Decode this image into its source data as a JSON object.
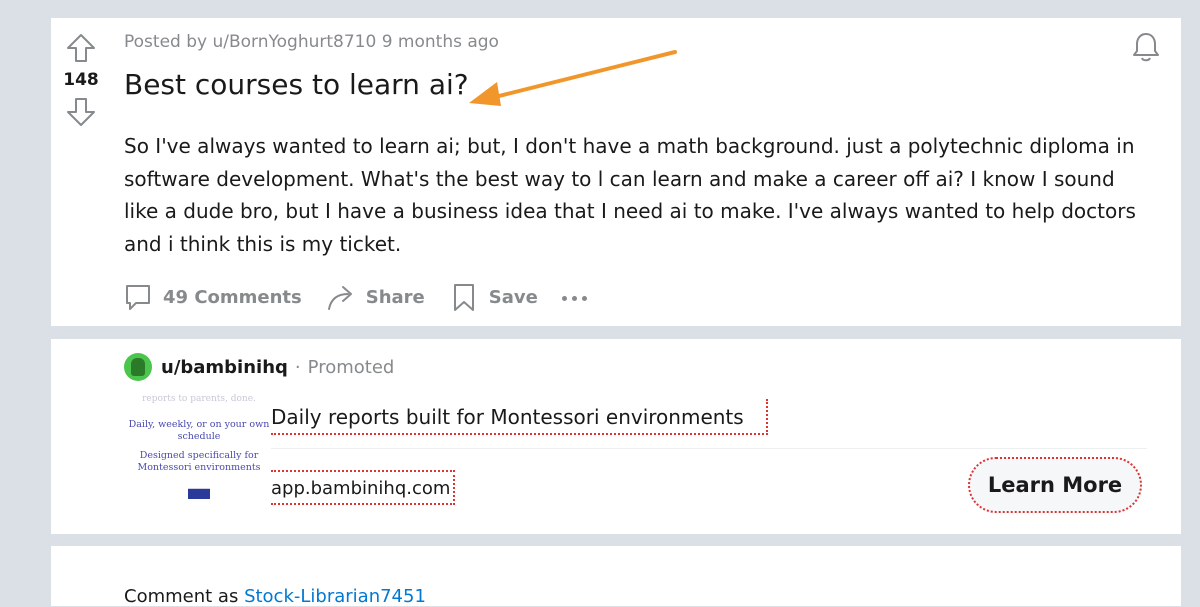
{
  "post": {
    "vote_count": "148",
    "posted_by": "Posted by u/BornYoghurt8710 9 months ago",
    "title": "Best courses to learn ai?",
    "body": "So I've always wanted to learn ai; but, I don't have a math background. just a polytechnic diploma in software development. What's the best way to l can learn and make a career off ai? I know I sound like a dude bro, but I have a business idea that I need ai to make. I've always wanted to help doctors and i think this is my ticket.",
    "actions": {
      "comments_label": "49 Comments",
      "share_label": "Share",
      "save_label": "Save"
    }
  },
  "ad": {
    "username": "u/bambinihq",
    "separator": "·",
    "promoted_label": "Promoted",
    "thumbnail": {
      "top_text": "reports to parents, done.",
      "line1": "Daily, weekly, or on your own schedule",
      "line2": "Designed specifically for Montessori environments"
    },
    "headline": "Daily reports built for Montessori environments",
    "link_text": "app.bambinihq.com",
    "cta_label": "Learn More"
  },
  "comment_box": {
    "prefix": "Comment as",
    "username": "Stock-Librarian7451"
  },
  "colors": {
    "page_bg": "#dae0e6",
    "muted_text": "#878a8c",
    "annotation_arrow": "#f0962a",
    "annotation_dots": "#dd3333",
    "link_blue": "#0079d3"
  },
  "icons": [
    "upvote-icon",
    "downvote-icon",
    "bell-icon",
    "comment-icon",
    "share-icon",
    "bookmark-icon",
    "more-icon"
  ]
}
